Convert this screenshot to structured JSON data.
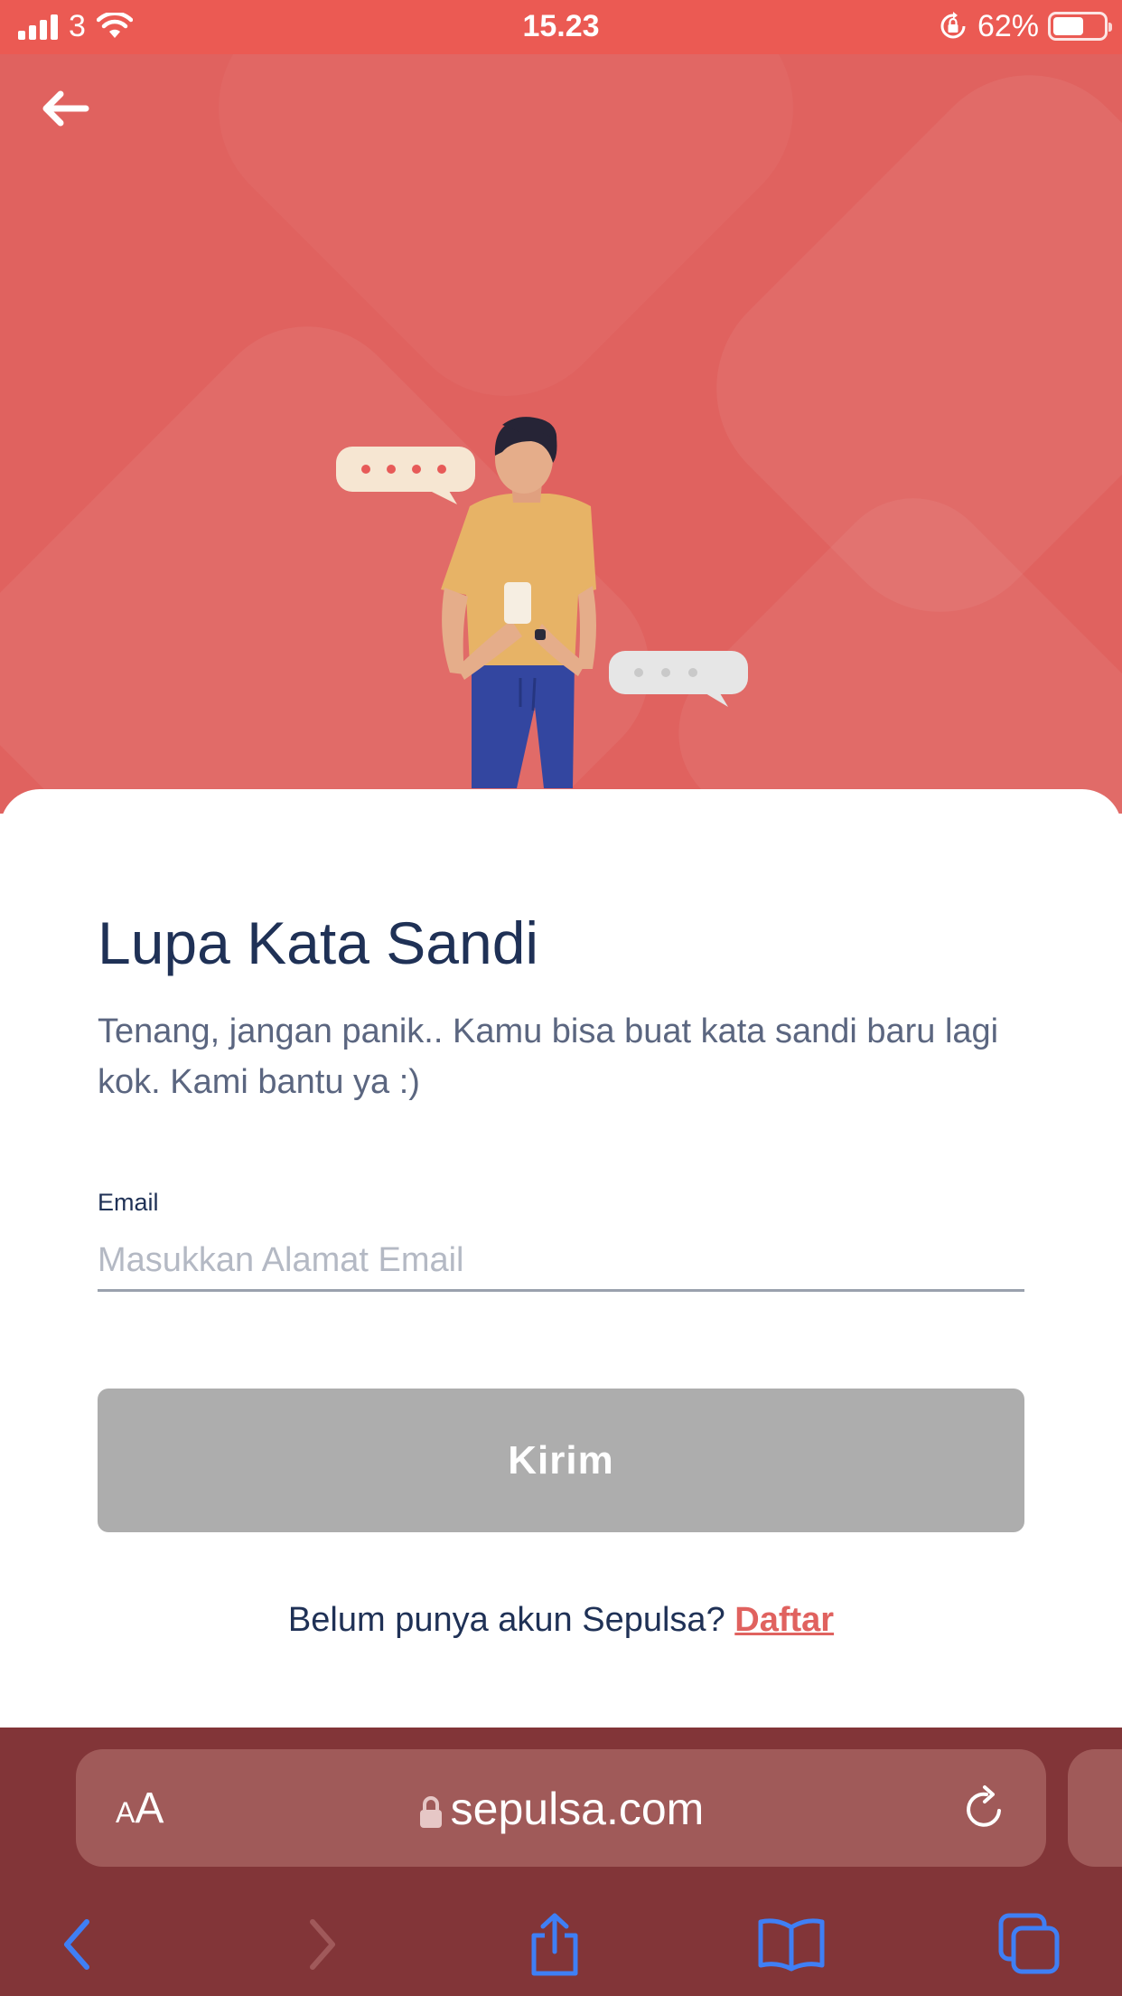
{
  "status_bar": {
    "carrier": "3",
    "time": "15.23",
    "battery_percent": "62%",
    "battery_level": 0.62
  },
  "header": {
    "back_icon": "arrow-left-icon"
  },
  "illustration": {
    "bubble_left_text": "✦✦✦✦",
    "bubble_right_text": "✦✦✦"
  },
  "form": {
    "title": "Lupa Kata Sandi",
    "subtitle": "Tenang, jangan panik.. Kamu bisa buat kata sandi baru lagi kok. Kami bantu ya :)",
    "email_label": "Email",
    "email_placeholder": "Masukkan Alamat Email",
    "email_value": "",
    "submit_label": "Kirim",
    "register_prompt": "Belum punya akun Sepulsa?",
    "register_link": "Daftar"
  },
  "browser": {
    "text_size_small": "A",
    "text_size_big": "A",
    "url": "sepulsa.com",
    "icons": [
      "back-icon",
      "forward-icon",
      "share-icon",
      "bookmarks-icon",
      "tabs-icon",
      "reload-icon",
      "lock-icon"
    ]
  },
  "colors": {
    "brand": "#e0625f",
    "status_bar": "#eb5a53",
    "title": "#1f3156",
    "button_disabled": "#adadad",
    "browser_bar": "#823538",
    "toolbar_icon": "#3f7ff5"
  }
}
